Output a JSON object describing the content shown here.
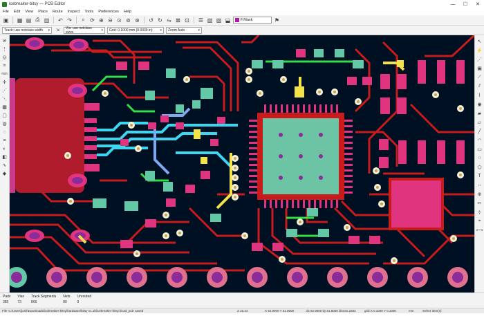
{
  "window": {
    "title": "icebreaker-bitsy — PCB Editor",
    "minimize_glyph": "—",
    "maximize_glyph": "☐",
    "close_glyph": "✕"
  },
  "menu": [
    "File",
    "Edit",
    "View",
    "Place",
    "Route",
    "Inspect",
    "Tools",
    "Preferences",
    "Help"
  ],
  "toolbar": {
    "icons": [
      "save-icon",
      "board-setup-icon",
      "page-settings-icon",
      "print-icon",
      "plot-icon",
      "undo-icon",
      "redo-icon",
      "search-icon",
      "refresh-icon",
      "zoom-in-icon",
      "zoom-out-icon",
      "zoom-fit-icon",
      "zoom-objects-icon",
      "zoom-selection-icon",
      "rotate-ccw-icon",
      "rotate-cw-icon",
      "flip-icon",
      "lock-icon",
      "unlock-icon",
      "netlist-icon",
      "footprint-editor-icon",
      "footprint-browser-icon",
      "update-pcb-icon",
      "drc-icon"
    ],
    "active_layer": "F.Mask",
    "active_layer_color": "#b01aa8"
  },
  "options": {
    "track": "Track: use netclass width",
    "via": "Via: use netclass sizes",
    "grid": "Grid: 0.1000 mm (0.0039 in)",
    "zoom": "Zoom Auto"
  },
  "left_toolbar_icons": [
    "drc-off-icon",
    "grid-icon",
    "polar-icon",
    "inch-icon",
    "mm-icon",
    "cursor-icon",
    "ratsnest-icon",
    "local-ratsnest-icon",
    "zone-fill-icon",
    "zone-outline-icon",
    "pad-sketch-icon",
    "via-sketch-icon",
    "track-sketch-icon",
    "high-contrast-icon",
    "layers-manager-icon",
    "microwave-icon",
    "python-icon"
  ],
  "right_toolbar_icons": [
    "select-icon",
    "highlight-net-icon",
    "local-ratsnest-icon",
    "footprint-add-icon",
    "route-track-icon",
    "route-diff-pair-icon",
    "tune-length-icon",
    "add-via-icon",
    "add-zone-icon",
    "add-keepout-icon",
    "add-graphic-line-icon",
    "add-arc-icon",
    "add-rectangle-icon",
    "add-circle-icon",
    "add-polygon-icon",
    "add-text-icon",
    "add-dimension-icon",
    "add-target-icon",
    "delete-icon",
    "set-origin-icon",
    "grid-origin-icon",
    "measure-icon"
  ],
  "messages": {
    "pads": {
      "label": "Pads",
      "value": "385"
    },
    "vias": {
      "label": "Vias",
      "value": "73"
    },
    "track_segments": {
      "label": "Track Segments",
      "value": "866"
    },
    "nets": {
      "label": "Nets",
      "value": "80"
    },
    "unrouted": {
      "label": "Unrouted",
      "value": "0"
    }
  },
  "status": {
    "file": "File 'C:\\Users\\josh\\Downloads\\icebreaker-bitsy\\hardware\\bitsy-v1.1b\\icebreaker-bitsy.kicad_pcb' saved",
    "zoom": "Z 15.44",
    "xy": "X 62.9000  Y 51.8000",
    "dxdy": "dx 62.9000  dy 51.8000  dist 81.2283",
    "grid": "grid X 0.1000  Y 0.1000",
    "units": "mm",
    "mode": "Select item(s)"
  },
  "colors": {
    "board_bg": "#001023",
    "copper_front": "#c81c1c",
    "pad_pink": "#e0357e",
    "pad_teal": "#62c8a6",
    "via_fill": "#f2f2da",
    "thermal_pad": "#6cc4a4",
    "highlight_yellow": "#f4e24c",
    "highlight_cyan": "#3cd6f0",
    "highlight_green": "#33dd44"
  }
}
